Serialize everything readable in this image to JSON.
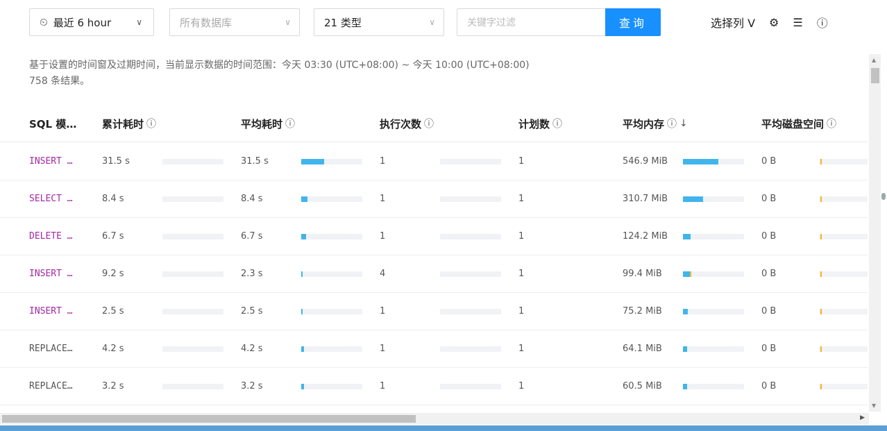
{
  "toolbar": {
    "time_label": "最近 6 hour",
    "db_placeholder": "所有数据库",
    "type_label": "21 类型",
    "search_placeholder": "关键字过滤",
    "search_button": "查询",
    "columns_label": "选择列 V"
  },
  "info": {
    "range_text": "基于设置的时间窗及过期时间，当前显示数据的时间范围：今天 03:30 (UTC+08:00) ~ 今天 10:00 (UTC+08:00)",
    "count_text": "758 条结果。"
  },
  "columns": {
    "sql": "SQL 模…",
    "total": "累计耗时",
    "avg": "平均耗时",
    "exec": "执行次数",
    "plans": "计划数",
    "mem": "平均内存",
    "disk": "平均磁盘空间"
  },
  "rows": [
    {
      "sql": "INSERT …",
      "kw": true,
      "total": "31.5 s",
      "avg": "31.5 s",
      "avg_frac": 0.38,
      "exec": "1",
      "plans": "1",
      "mem": "546.9 MiB",
      "mem_frac": 0.58,
      "mem_y": false,
      "disk": "0 B"
    },
    {
      "sql": "SELECT …",
      "kw": true,
      "total": "8.4 s",
      "avg": "8.4 s",
      "avg_frac": 0.1,
      "exec": "1",
      "plans": "1",
      "mem": "310.7 MiB",
      "mem_frac": 0.33,
      "mem_y": false,
      "disk": "0 B"
    },
    {
      "sql": "DELETE …",
      "kw": true,
      "total": "6.7 s",
      "avg": "6.7 s",
      "avg_frac": 0.08,
      "exec": "1",
      "plans": "1",
      "mem": "124.2 MiB",
      "mem_frac": 0.13,
      "mem_y": false,
      "disk": "0 B"
    },
    {
      "sql": "INSERT …",
      "kw": true,
      "total": "9.2 s",
      "avg": "2.3 s",
      "avg_frac": 0.02,
      "exec": "4",
      "plans": "1",
      "mem": "99.4 MiB",
      "mem_frac": 0.11,
      "mem_y": true,
      "disk": "0 B"
    },
    {
      "sql": "INSERT …",
      "kw": true,
      "total": "2.5 s",
      "avg": "2.5 s",
      "avg_frac": 0.02,
      "exec": "1",
      "plans": "1",
      "mem": "75.2 MiB",
      "mem_frac": 0.08,
      "mem_y": false,
      "disk": "0 B"
    },
    {
      "sql": "REPLACE…",
      "kw": false,
      "total": "4.2 s",
      "avg": "4.2 s",
      "avg_frac": 0.05,
      "exec": "1",
      "plans": "1",
      "mem": "64.1 MiB",
      "mem_frac": 0.07,
      "mem_y": false,
      "disk": "0 B"
    },
    {
      "sql": "REPLACE…",
      "kw": false,
      "total": "3.2 s",
      "avg": "3.2 s",
      "avg_frac": 0.04,
      "exec": "1",
      "plans": "1",
      "mem": "60.5 MiB",
      "mem_frac": 0.07,
      "mem_y": false,
      "disk": "0 B"
    }
  ],
  "colors": {
    "bar": "#40b5ec",
    "accent": "#1890ff",
    "keyword": "#a626a4",
    "disk_bar": "#f5b322"
  }
}
